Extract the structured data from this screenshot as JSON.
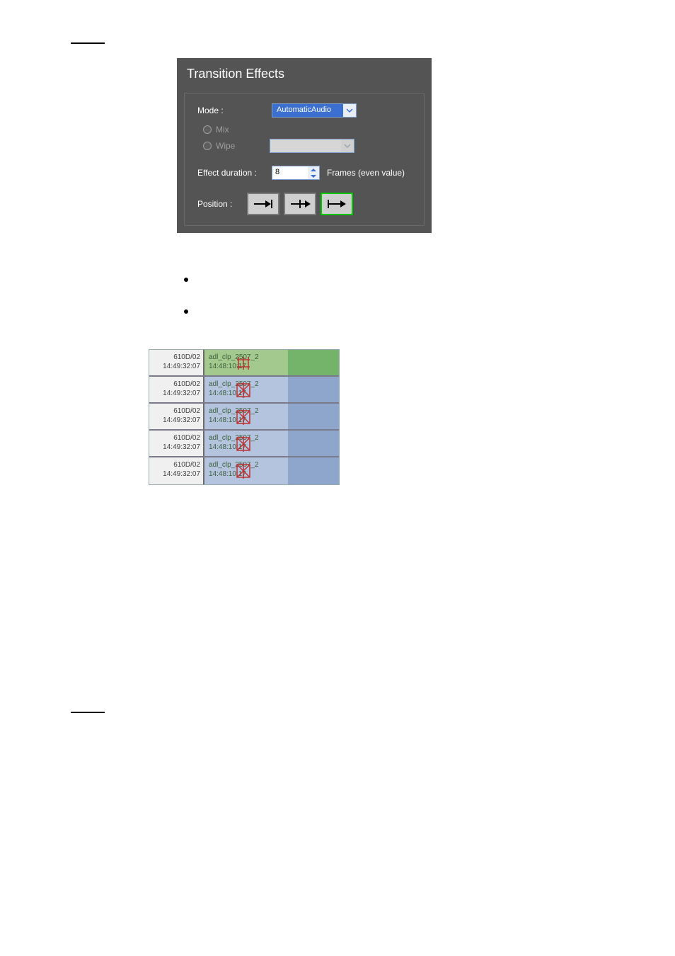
{
  "panel": {
    "title": "Transition Effects",
    "mode_label": "Mode :",
    "mode_value": "AutomaticAudio",
    "mix_label": "Mix",
    "wipe_label": "Wipe",
    "duration_label": "Effect duration :",
    "duration_value": "8",
    "duration_suffix": "Frames (even value)",
    "position_label": "Position :"
  },
  "clips": [
    {
      "code": "610D/02",
      "tc_left": "14:49:32:07",
      "name": "adl_clp_2507_2",
      "tc_right": "14:48:10:17",
      "style": "green"
    },
    {
      "code": "610D/02",
      "tc_left": "14:49:32:07",
      "name": "adl_clp_2507_2",
      "tc_right": "14:48:10:17",
      "style": "blue"
    },
    {
      "code": "610D/02",
      "tc_left": "14:49:32:07",
      "name": "adl_clp_2507_2",
      "tc_right": "14:48:10:17",
      "style": "blue"
    },
    {
      "code": "610D/02",
      "tc_left": "14:49:32:07",
      "name": "adl_clp_2507_2",
      "tc_right": "14:48:10:17",
      "style": "blue"
    },
    {
      "code": "610D/02",
      "tc_left": "14:49:32:07",
      "name": "adl_clp_2507_2",
      "tc_right": "14:48:10:17",
      "style": "blue"
    }
  ]
}
